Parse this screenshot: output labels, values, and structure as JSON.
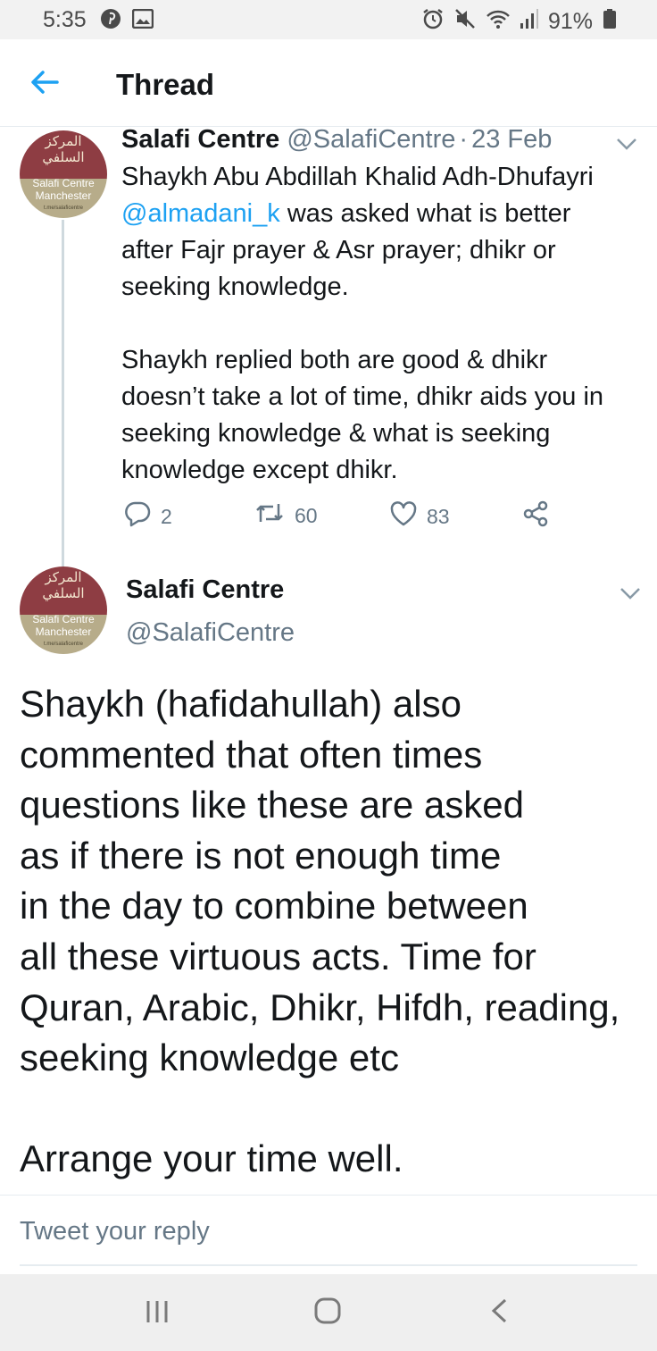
{
  "status_bar": {
    "time": "5:35",
    "battery": "91%",
    "icons": [
      "pinterest-icon",
      "gallery-icon",
      "alarm-icon",
      "mute-icon",
      "wifi-icon",
      "signal-icon",
      "battery-icon"
    ]
  },
  "header": {
    "title": "Thread",
    "back_icon": "arrow-left-icon"
  },
  "avatar": {
    "arabic_line1": "المركز",
    "arabic_line2": "السلفي",
    "banner_line1": "Salafi Centre",
    "banner_line2": "Manchester",
    "url": "t.me/salaficentre"
  },
  "tweet1": {
    "name": "Salafi Centre",
    "handle": "@SalafiCentre",
    "separator": "·",
    "date": "23 Feb",
    "lines": [
      "Shaykh Abu Abdillah Khalid Adh-Dhufayri",
      "was asked what is better",
      "after Fajr prayer & Asr prayer; dhikr or",
      "seeking knowledge."
    ],
    "mention": "@almadani_k",
    "lines2": [
      "Shaykh replied both are good & dhikr",
      "doesn’t take a lot of time, dhikr aids you in",
      "seeking knowledge & what is seeking",
      "knowledge except dhikr."
    ],
    "replies": "2",
    "retweets": "60",
    "likes": "83"
  },
  "tweet2": {
    "name": "Salafi Centre",
    "handle": "@SalafiCentre",
    "lines": [
      "Shaykh (hafidahullah) also",
      "commented that often times",
      "questions like these are asked",
      "as if there is not enough time",
      "in the day to combine between",
      "all these virtuous acts. Time for",
      "Quran, Arabic, Dhikr, Hifdh, reading,",
      "seeking knowledge etc"
    ],
    "closing": "Arrange your time well."
  },
  "reply": {
    "placeholder": "Tweet your reply"
  },
  "colors": {
    "accent": "#1da1f2",
    "text": "#14171a",
    "secondary": "#657786",
    "avatar_top": "#8e3d43",
    "avatar_bottom": "#b7ac8a"
  }
}
